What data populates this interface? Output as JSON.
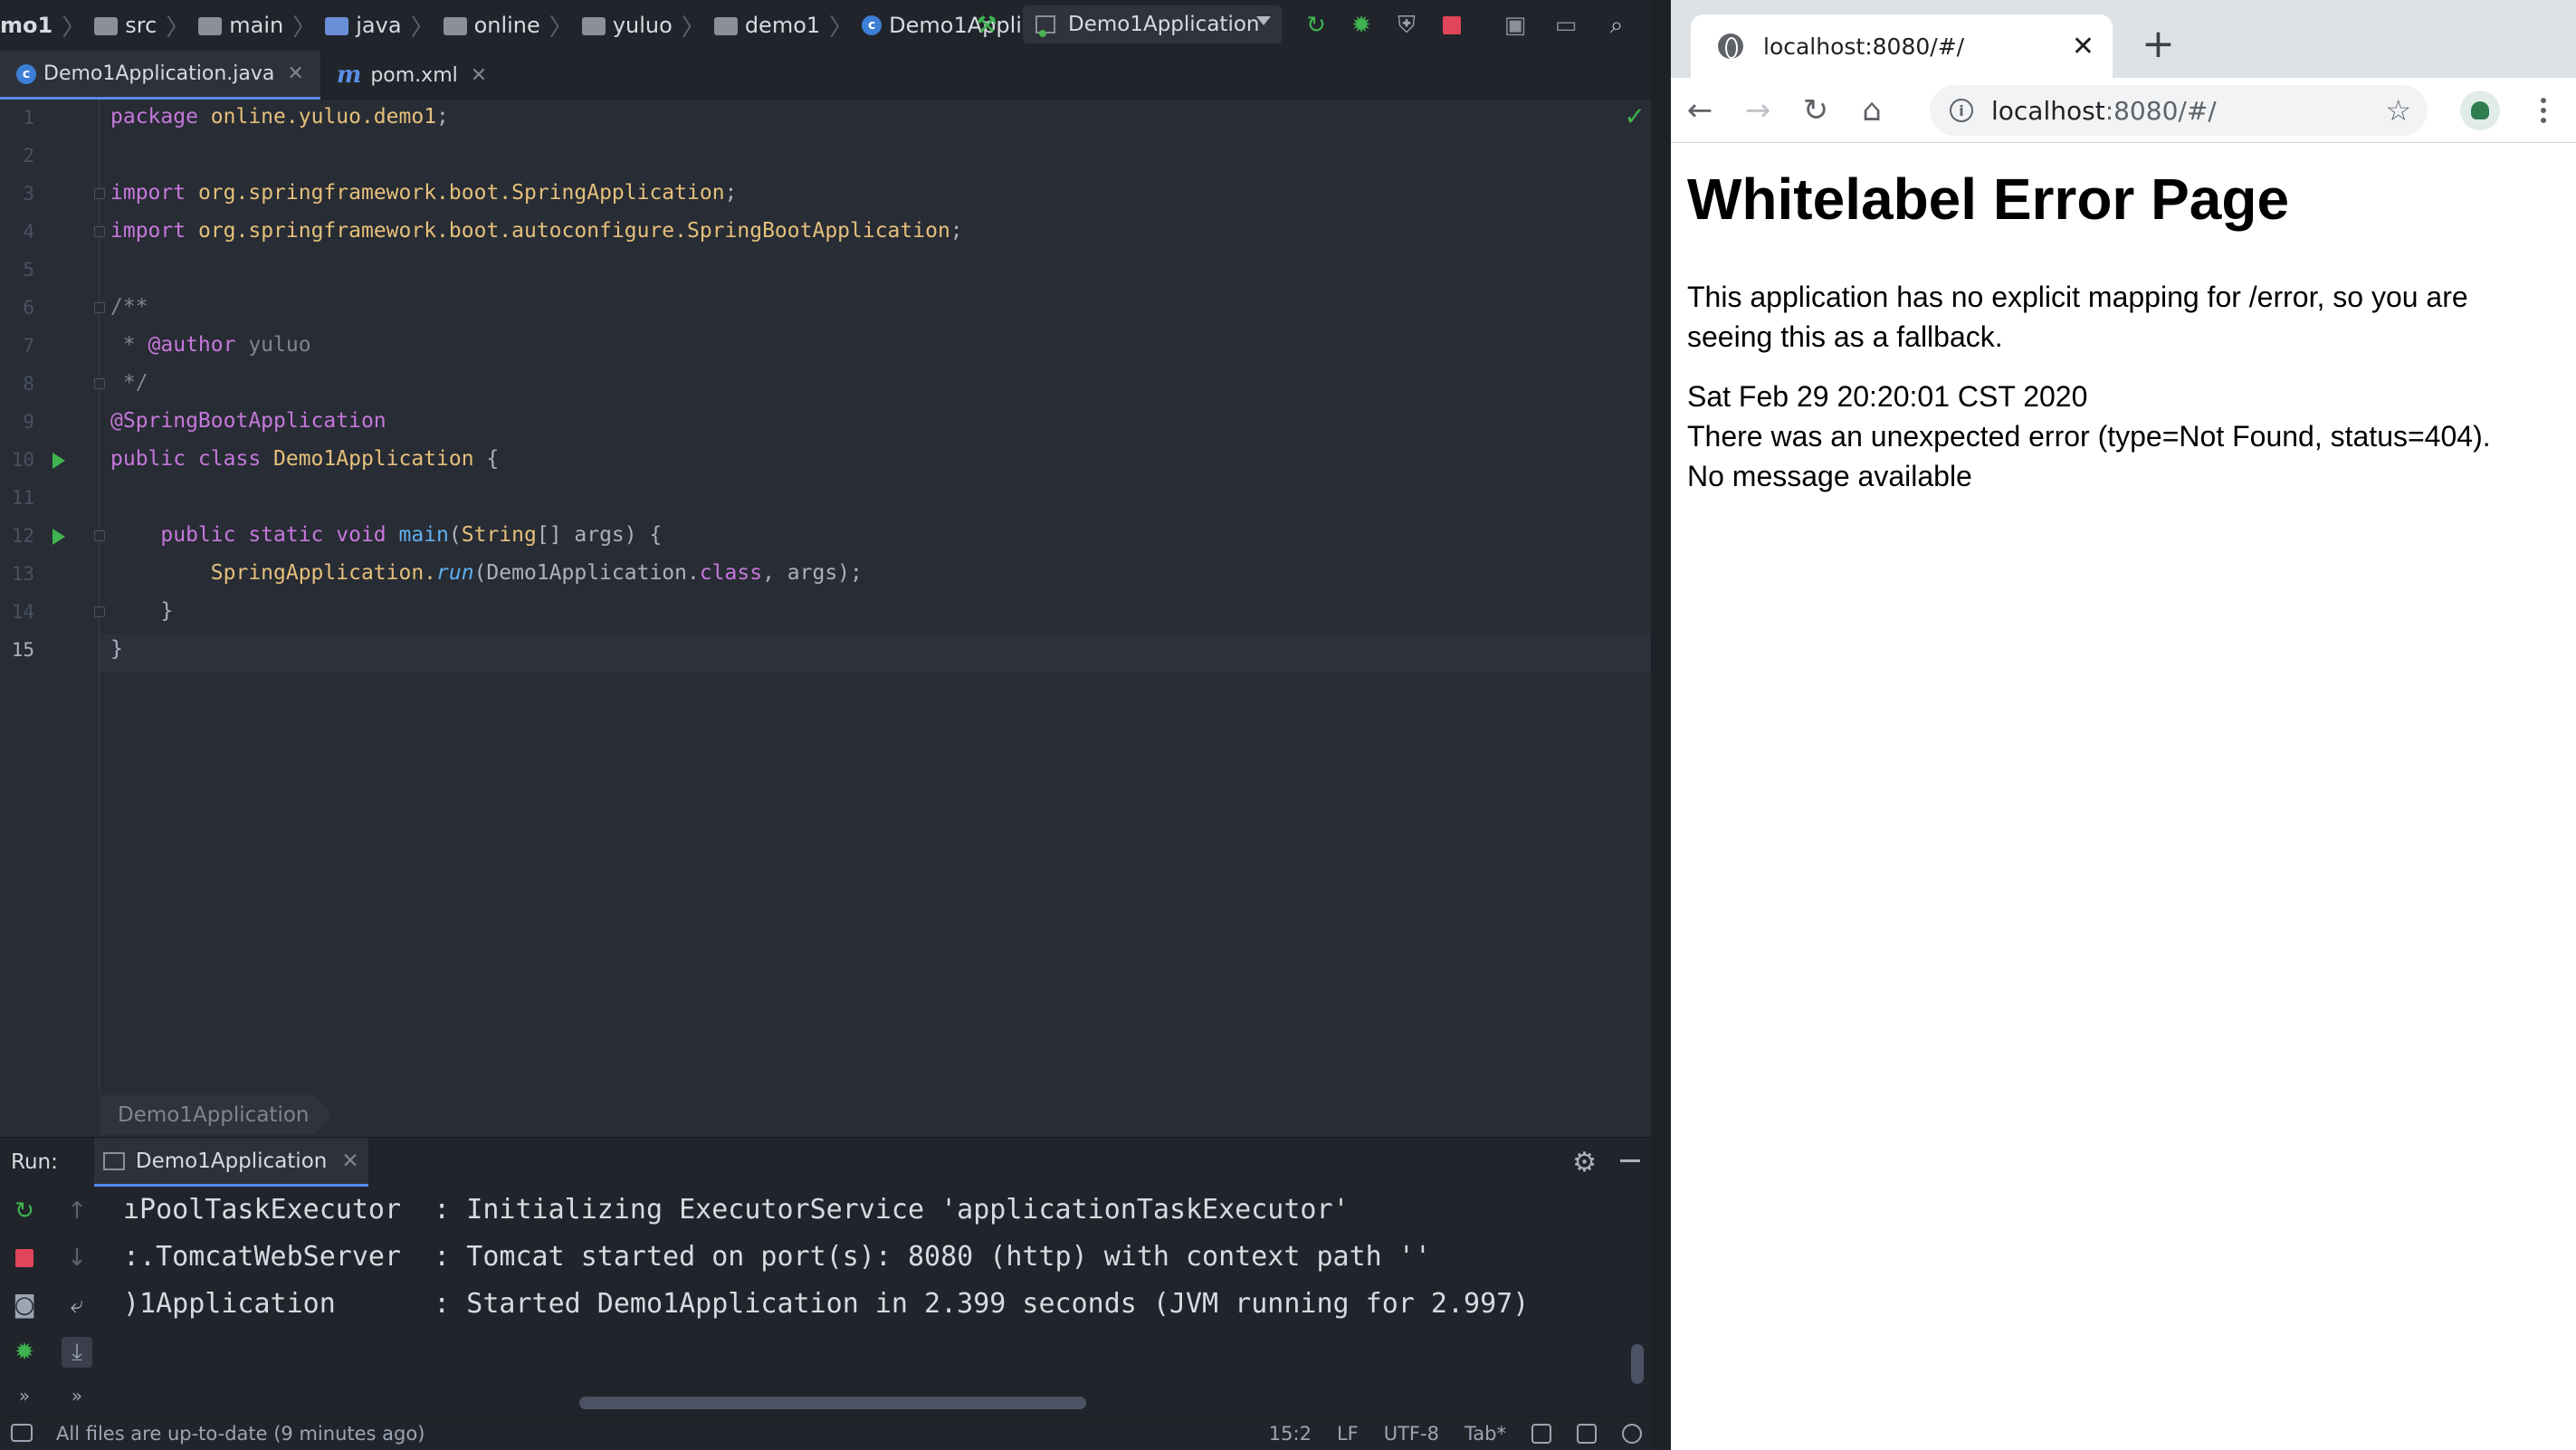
{
  "ide": {
    "breadcrumbs": [
      "mo1",
      "src",
      "main",
      "java",
      "online",
      "yuluo",
      "demo1",
      "Demo1Application"
    ],
    "run_config": "Demo1Application",
    "tabs": [
      {
        "label": "Demo1Application.java",
        "icon": "java-class-icon"
      },
      {
        "label": "pom.xml",
        "icon": "maven-icon"
      }
    ],
    "line_numbers": [
      "1",
      "2",
      "3",
      "4",
      "5",
      "6",
      "7",
      "8",
      "9",
      "10",
      "11",
      "12",
      "13",
      "14",
      "15"
    ],
    "code": {
      "l1_kw": "package",
      "l1_pkg": "online.yuluo.demo1",
      "l1_end": ";",
      "l3_kw": "import",
      "l3_pkg": "org.springframework.boot.",
      "l3_cls": "SpringApplication",
      "l3_end": ";",
      "l4_kw": "import",
      "l4_pkg": "org.springframework.boot.autoconfigure.",
      "l4_cls": "SpringBootApplication",
      "l4_end": ";",
      "l6": "/**",
      "l7_a": " * ",
      "l7_tag": "@author",
      "l7_b": " yuluo",
      "l8": " */",
      "l9": "@SpringBootApplication",
      "l10_kw": "public class ",
      "l10_cls": "Demo1Application",
      "l10_end": " {",
      "l12_kw": "    public static void ",
      "l12_fn": "main",
      "l12_a": "(",
      "l12_ty": "String",
      "l12_b": "[] args) {",
      "l13_cls": "        SpringApplication.",
      "l13_fn": "run",
      "l13_a": "(Demo1Application.",
      "l13_kw": "class",
      "l13_b": ", args);",
      "l14": "    }",
      "l15": "}"
    },
    "structure_hint": "Demo1Application",
    "run_panel": {
      "label": "Run:",
      "tab": "Demo1Application",
      "console": [
        "ıPoolTaskExecutor  : Initializing ExecutorService 'applicationTaskExecutor'",
        ":.TomcatWebServer  : Tomcat started on port(s): 8080 (http) with context path ''",
        ")1Application      : Started Demo1Application in 2.399 seconds (JVM running for 2.997)"
      ]
    },
    "status": {
      "message": "All files are up-to-date (9 minutes ago)",
      "position": "15:2",
      "line_sep": "LF",
      "encoding": "UTF-8",
      "indent": "Tab*"
    }
  },
  "browser": {
    "tab_title": "localhost:8080/#/",
    "url_host": "localhost",
    "url_rest": ":8080/#/",
    "page": {
      "title": "Whitelabel Error Page",
      "message": "This application has no explicit mapping for /error, so you are seeing this as a fallback.",
      "timestamp": "Sat Feb 29 20:20:01 CST 2020",
      "error": "There was an unexpected error (type=Not Found, status=404).",
      "detail": "No message available"
    }
  }
}
